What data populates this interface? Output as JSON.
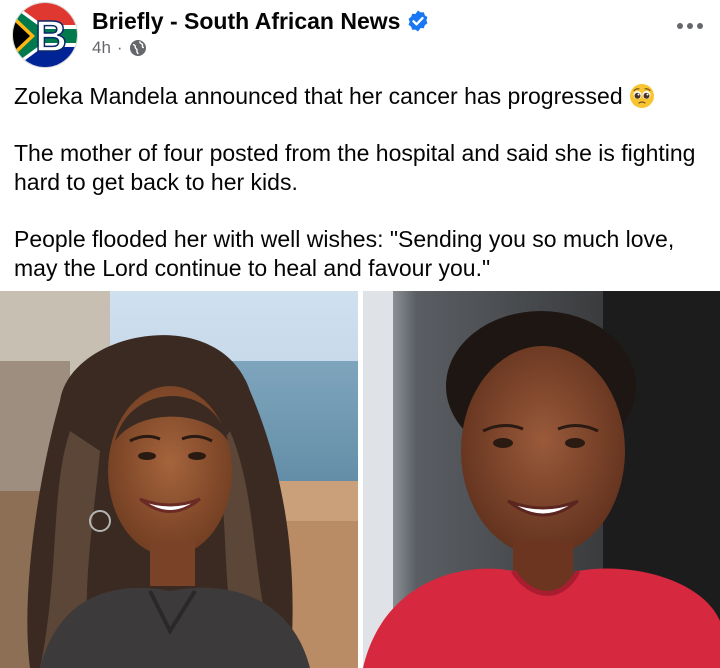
{
  "header": {
    "page_name": "Briefly - South African News",
    "time": "4h",
    "separator": "·",
    "avatar_letter": "B",
    "verified_icon": "verified-badge-icon",
    "privacy_icon": "globe-icon",
    "more_icon": "more-options-icon"
  },
  "post": {
    "line1": "Zoleka Mandela announced that her cancer has progressed",
    "emoji": "pleading-face-emoji",
    "para2": "The mother of four posted from the hospital and said she is fighting hard to get back to her kids.",
    "para3": "People flooded her with well wishes: \"Sending you so much love, may the Lord continue to heal and favour you.\""
  },
  "colors": {
    "accent_blue": "#1877f2",
    "secondary_text": "#65676b",
    "primary_text": "#050505",
    "shirt_red": "#d6283f"
  }
}
